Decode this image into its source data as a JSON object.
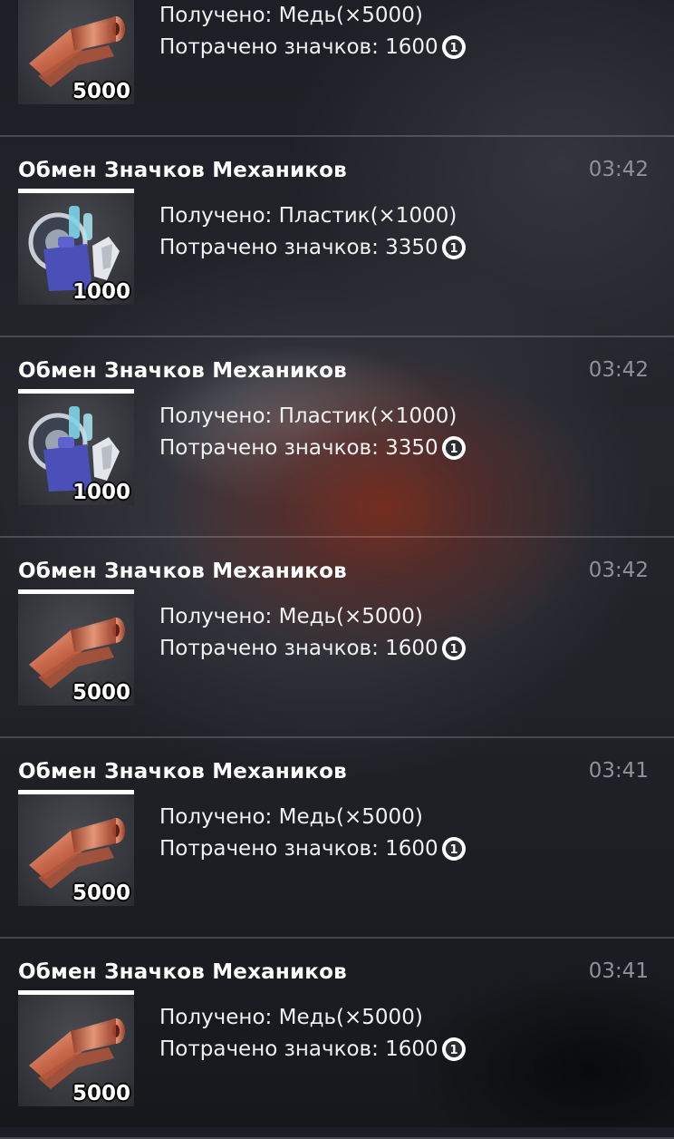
{
  "icons": {
    "copper": "copper-sheet-roll-icon",
    "plastic": "plastic-materials-icon",
    "badge": "mechanic-badge-icon"
  },
  "entries": [
    {
      "title": "",
      "time": "",
      "received_label": "Получено:",
      "received_item": "Медь(×5000)",
      "spent_label": "Потрачено значков:",
      "spent_value": "1600",
      "icon": "copper",
      "qty": "5000"
    },
    {
      "title": "Обмен Значков Механиков",
      "time": "03:42",
      "received_label": "Получено:",
      "received_item": "Пластик(×1000)",
      "spent_label": "Потрачено значков:",
      "spent_value": "3350",
      "icon": "plastic",
      "qty": "1000"
    },
    {
      "title": "Обмен Значков Механиков",
      "time": "03:42",
      "received_label": "Получено:",
      "received_item": "Пластик(×1000)",
      "spent_label": "Потрачено значков:",
      "spent_value": "3350",
      "icon": "plastic",
      "qty": "1000"
    },
    {
      "title": "Обмен Значков Механиков",
      "time": "03:42",
      "received_label": "Получено:",
      "received_item": "Медь(×5000)",
      "spent_label": "Потрачено значков:",
      "spent_value": "1600",
      "icon": "copper",
      "qty": "5000"
    },
    {
      "title": "Обмен Значков Механиков",
      "time": "03:41",
      "received_label": "Получено:",
      "received_item": "Медь(×5000)",
      "spent_label": "Потрачено значков:",
      "spent_value": "1600",
      "icon": "copper",
      "qty": "5000"
    },
    {
      "title": "Обмен Значков Механиков",
      "time": "03:41",
      "received_label": "Получено:",
      "received_item": "Медь(×5000)",
      "spent_label": "Потрачено значков:",
      "spent_value": "1600",
      "icon": "copper",
      "qty": "5000"
    }
  ]
}
